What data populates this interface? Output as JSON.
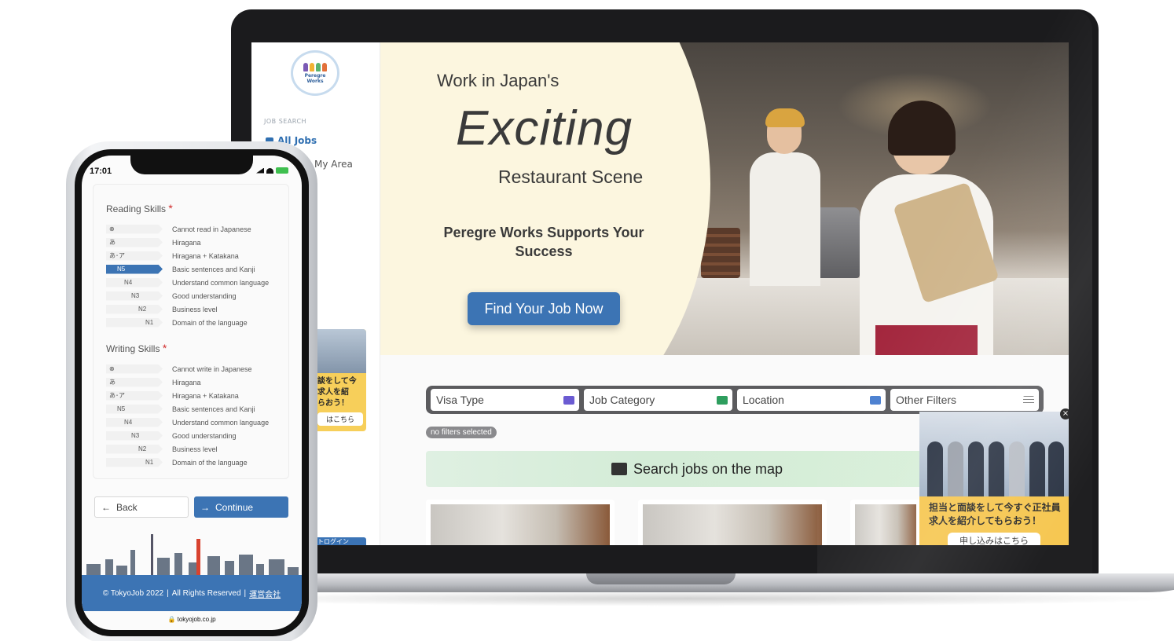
{
  "laptop": {
    "sidebar": {
      "logo_text_1": "Peregre",
      "logo_text_2": "Works",
      "section_label": "JOB SEARCH",
      "items": [
        {
          "label": "All Jobs",
          "icon": "briefcase-icon"
        },
        {
          "label": "My Area",
          "icon": "map-pin-icon"
        }
      ],
      "ad_text": "談をして今\n求人を紹\nらおう！",
      "ad_button": "はこちら",
      "login_label": "トログイン"
    },
    "hero": {
      "line1": "Work in Japan's",
      "line2": "Exciting",
      "line3": "Restaurant Scene",
      "tagline": "Peregre Works Supports Your Success",
      "cta": "Find Your Job Now"
    },
    "filters": [
      {
        "label": "Visa Type",
        "icon": "id-card-icon",
        "color": "#6b5bd2"
      },
      {
        "label": "Job Category",
        "icon": "briefcase-icon",
        "color": "#2e9e5e"
      },
      {
        "label": "Location",
        "icon": "map-icon",
        "color": "#4a7fd0"
      },
      {
        "label": "Other Filters",
        "icon": "sliders-icon",
        "color": "#777777"
      }
    ],
    "no_filters": "no filters selected",
    "map_search": "Search jobs on the map",
    "popup": {
      "text": "担当と面談をして今すぐ正社員求人を紹介してもらおう！",
      "button": "申し込みはこちら",
      "close": "×"
    }
  },
  "phone": {
    "time": "17:01",
    "reading": {
      "title": "Reading Skills",
      "required": "*",
      "rows": [
        {
          "tag": "⊗",
          "desc": "Cannot read in Japanese",
          "selected": false
        },
        {
          "tag": "あ",
          "desc": "Hiragana",
          "selected": false
        },
        {
          "tag": "あ･ア",
          "desc": "Hiragana + Katakana",
          "selected": false
        },
        {
          "tag": "N5",
          "desc": "Basic sentences and Kanji",
          "selected": true
        },
        {
          "tag": "N4",
          "desc": "Understand common language",
          "selected": false
        },
        {
          "tag": "N3",
          "desc": "Good understanding",
          "selected": false
        },
        {
          "tag": "N2",
          "desc": "Business level",
          "selected": false
        },
        {
          "tag": "N1",
          "desc": "Domain of the language",
          "selected": false
        }
      ]
    },
    "writing": {
      "title": "Writing Skills",
      "required": "*",
      "rows": [
        {
          "tag": "⊗",
          "desc": "Cannot write in Japanese",
          "selected": false
        },
        {
          "tag": "あ",
          "desc": "Hiragana",
          "selected": false
        },
        {
          "tag": "あ･ア",
          "desc": "Hiragana + Katakana",
          "selected": false
        },
        {
          "tag": "N5",
          "desc": "Basic sentences and Kanji",
          "selected": false
        },
        {
          "tag": "N4",
          "desc": "Understand common language",
          "selected": false
        },
        {
          "tag": "N3",
          "desc": "Good understanding",
          "selected": false
        },
        {
          "tag": "N2",
          "desc": "Business level",
          "selected": false
        },
        {
          "tag": "N1",
          "desc": "Domain of the language",
          "selected": false
        }
      ]
    },
    "back": "Back",
    "continue": "Continue",
    "footer": {
      "copyright": "© TokyoJob 2022",
      "rights": "All Rights Reserved",
      "company_link": "運営会社",
      "separator": "|"
    },
    "url": "tokyojob.co.jp"
  },
  "colors": {
    "accent": "#3c74b4",
    "required": "#d02b2b",
    "popup": "#f6c64f",
    "map_bar": "#d4ecd7"
  }
}
